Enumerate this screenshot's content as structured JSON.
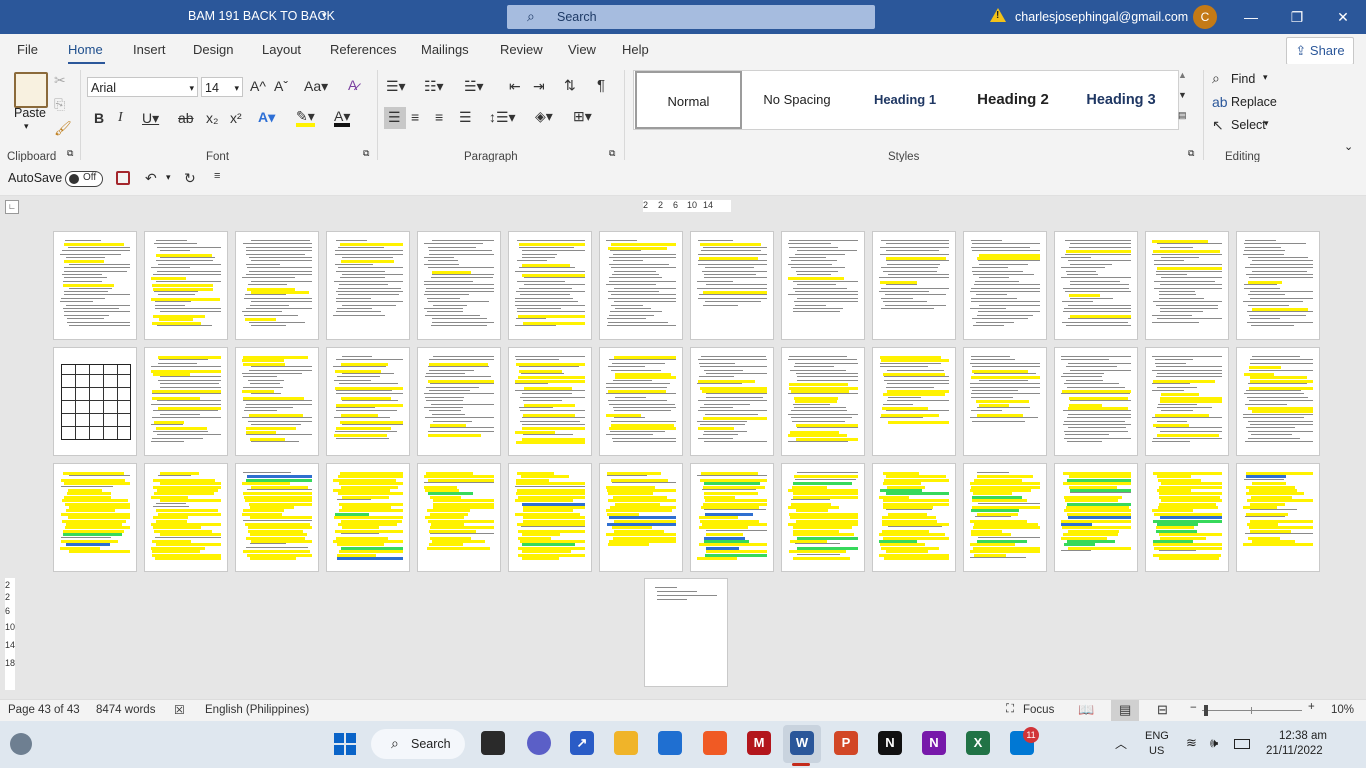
{
  "titlebar": {
    "doc_title": "BAM 191 BACK TO BACK",
    "search_placeholder": "Search",
    "account_email": "charlesjosephingal@gmail.com",
    "avatar_initial": "C",
    "minimize": "—",
    "restore": "❐",
    "close": "✕"
  },
  "tabs": [
    "File",
    "Home",
    "Insert",
    "Design",
    "Layout",
    "References",
    "Mailings",
    "Review",
    "View",
    "Help"
  ],
  "share_label": "Share",
  "ribbon": {
    "clipboard": {
      "label": "Clipboard",
      "paste": "Paste"
    },
    "font": {
      "label": "Font",
      "name": "Arial",
      "size": "14"
    },
    "paragraph": {
      "label": "Paragraph"
    },
    "styles": {
      "label": "Styles",
      "items": [
        "Normal",
        "No Spacing",
        "Heading 1",
        "Heading 2",
        "Heading 3"
      ]
    },
    "editing": {
      "label": "Editing",
      "find": "Find",
      "replace": "Replace",
      "select": "Select"
    }
  },
  "qat": {
    "autosave": "AutoSave",
    "toggle_state": "Off"
  },
  "ruler": {
    "marks": [
      "2",
      "2",
      "6",
      "10",
      "14"
    ],
    "vmarks": [
      "2",
      "2",
      "6",
      "10",
      "14",
      "18"
    ]
  },
  "status": {
    "page": "Page 43 of 43",
    "words": "8474 words",
    "language": "English (Philippines)",
    "focus": "Focus",
    "zoom": "10%"
  },
  "taskbar": {
    "search": "Search",
    "lang_top": "ENG",
    "lang_bottom": "US",
    "time": "12:38 am",
    "date": "21/11/2022",
    "badge": "11"
  },
  "colors": {
    "accent": "#2b579a",
    "highlight": "#fff200",
    "green_highlight": "#36d95b"
  }
}
